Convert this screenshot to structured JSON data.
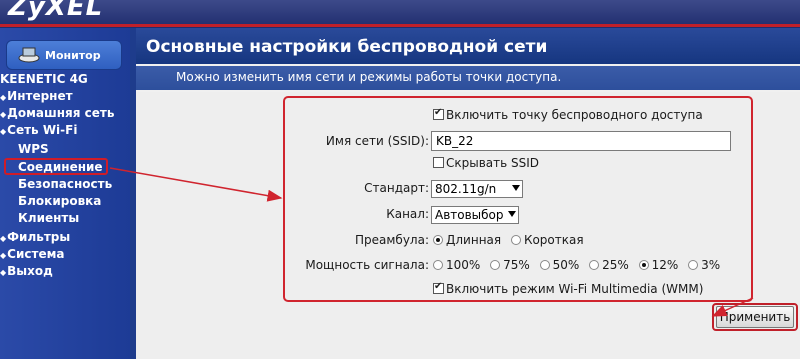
{
  "brand": {
    "logo": "ZyXEL"
  },
  "sidebar": {
    "monitor_label": "Монитор",
    "model": "KEENETIC 4G",
    "items": [
      {
        "label": "Интернет"
      },
      {
        "label": "Домашняя сеть"
      },
      {
        "label": "Сеть Wi-Fi"
      }
    ],
    "wifi_sub": [
      {
        "label": "WPS"
      },
      {
        "label": "Соединение"
      },
      {
        "label": "Безопасность"
      },
      {
        "label": "Блокировка"
      },
      {
        "label": "Клиенты"
      }
    ],
    "bottom_items": [
      {
        "label": "Фильтры"
      },
      {
        "label": "Система"
      },
      {
        "label": "Выход"
      }
    ]
  },
  "page": {
    "title": "Основные настройки беспроводной сети",
    "subtitle": "Можно изменить имя сети и режимы работы точки доступа."
  },
  "form": {
    "enable_ap": {
      "label": "Включить точку беспроводного доступа",
      "checked": true
    },
    "ssid": {
      "label": "Имя сети (SSID):",
      "value": "KB_22"
    },
    "hide_ssid": {
      "label": "Скрывать SSID",
      "checked": false
    },
    "standard": {
      "label": "Стандарт:",
      "value": "802.11g/n"
    },
    "channel": {
      "label": "Канал:",
      "value": "Автовыбор"
    },
    "preamble": {
      "label": "Преамбула:",
      "options": [
        "Длинная",
        "Короткая"
      ],
      "selected": "Длинная"
    },
    "power": {
      "label": "Мощность сигнала:",
      "options": [
        "100%",
        "75%",
        "50%",
        "25%",
        "12%",
        "3%"
      ],
      "selected": "12%"
    },
    "wmm": {
      "label": "Включить режим Wi-Fi Multimedia (WMM)",
      "checked": true
    },
    "apply_label": "Применить"
  },
  "colors": {
    "annotation_red": "#d0242e",
    "nav_blue": "#1d3b96",
    "header_blue": "#163680"
  }
}
